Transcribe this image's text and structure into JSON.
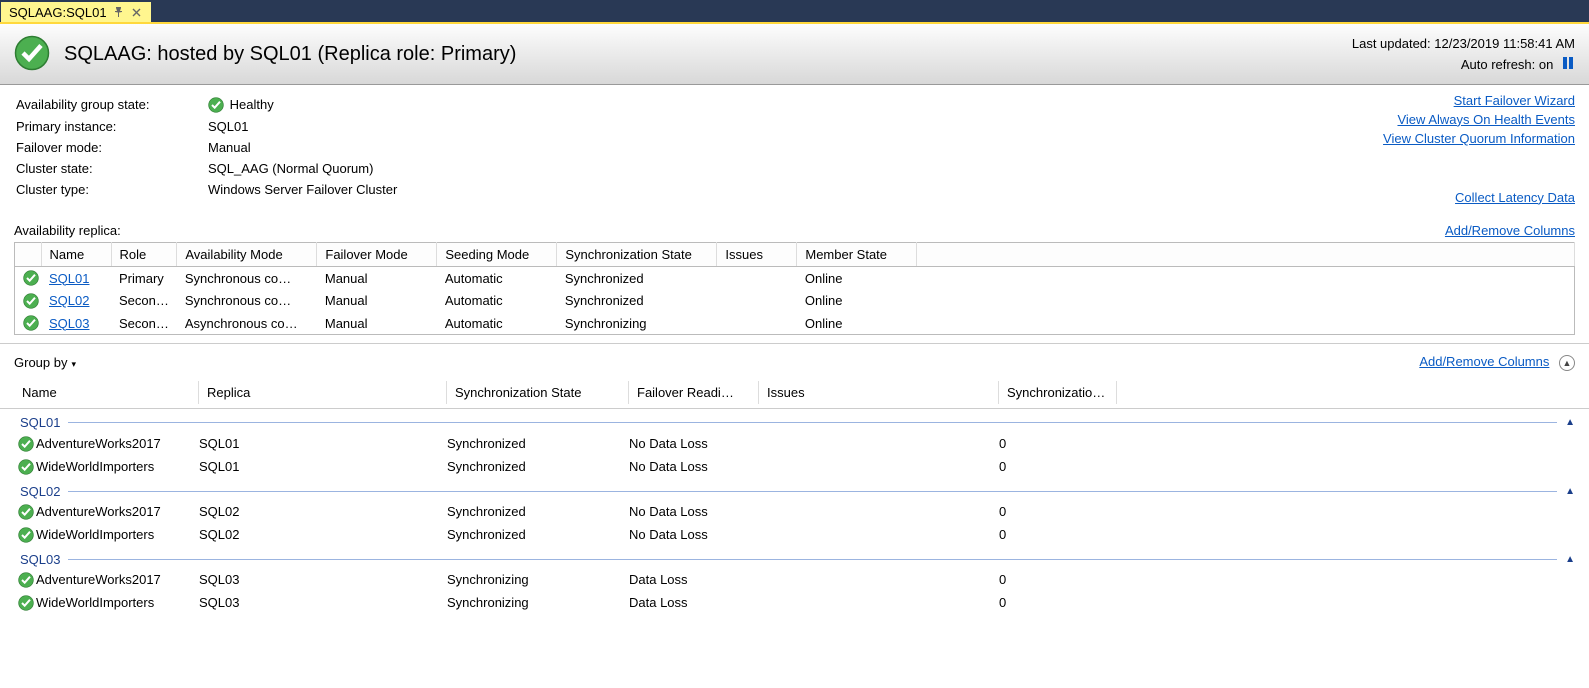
{
  "tab": {
    "title": "SQLAAG:SQL01"
  },
  "header": {
    "title": "SQLAAG: hosted by SQL01 (Replica role: Primary)",
    "lastUpdatedLabel": "Last updated:",
    "lastUpdatedValue": "12/23/2019 11:58:41 AM",
    "autoRefreshLabel": "Auto refresh:",
    "autoRefreshValue": "on"
  },
  "info": {
    "rows": [
      {
        "label": "Availability group state:",
        "value": "Healthy",
        "icon": true
      },
      {
        "label": "Primary instance:",
        "value": "SQL01"
      },
      {
        "label": "Failover mode:",
        "value": "Manual"
      },
      {
        "label": "Cluster state:",
        "value": "SQL_AAG (Normal Quorum)"
      },
      {
        "label": "Cluster type:",
        "value": "Windows Server Failover Cluster"
      }
    ],
    "links": {
      "failoverWizard": "Start Failover Wizard",
      "healthEvents": "View Always On Health Events",
      "quorum": "View Cluster Quorum Information",
      "latency": "Collect Latency Data"
    }
  },
  "replicaSection": {
    "label": "Availability replica:",
    "addRemove": "Add/Remove Columns",
    "headers": [
      "Name",
      "Role",
      "Availability Mode",
      "Failover Mode",
      "Seeding Mode",
      "Synchronization State",
      "Issues",
      "Member State"
    ],
    "rows": [
      {
        "name": "SQL01",
        "role": "Primary",
        "mode": "Synchronous co…",
        "failover": "Manual",
        "seeding": "Automatic",
        "sync": "Synchronized",
        "issues": "",
        "member": "Online"
      },
      {
        "name": "SQL02",
        "role": "Secon…",
        "mode": "Synchronous co…",
        "failover": "Manual",
        "seeding": "Automatic",
        "sync": "Synchronized",
        "issues": "",
        "member": "Online"
      },
      {
        "name": "SQL03",
        "role": "Secon…",
        "mode": "Asynchronous co…",
        "failover": "Manual",
        "seeding": "Automatic",
        "sync": "Synchronizing",
        "issues": "",
        "member": "Online"
      }
    ]
  },
  "dbSection": {
    "groupBy": "Group by",
    "addRemove": "Add/Remove Columns",
    "headers": {
      "name": "Name",
      "replica": "Replica",
      "sync": "Synchronization State",
      "failover": "Failover Readi…",
      "issues": "Issues",
      "perf": "Synchronizatio…"
    },
    "groups": [
      {
        "name": "SQL01",
        "rows": [
          {
            "db": "AdventureWorks2017",
            "replica": "SQL01",
            "sync": "Synchronized",
            "failover": "No Data Loss",
            "issues": "",
            "perf": "0"
          },
          {
            "db": "WideWorldImporters",
            "replica": "SQL01",
            "sync": "Synchronized",
            "failover": "No Data Loss",
            "issues": "",
            "perf": "0"
          }
        ]
      },
      {
        "name": "SQL02",
        "rows": [
          {
            "db": "AdventureWorks2017",
            "replica": "SQL02",
            "sync": "Synchronized",
            "failover": "No Data Loss",
            "issues": "",
            "perf": "0"
          },
          {
            "db": "WideWorldImporters",
            "replica": "SQL02",
            "sync": "Synchronized",
            "failover": "No Data Loss",
            "issues": "",
            "perf": "0"
          }
        ]
      },
      {
        "name": "SQL03",
        "rows": [
          {
            "db": "AdventureWorks2017",
            "replica": "SQL03",
            "sync": "Synchronizing",
            "failover": "Data Loss",
            "issues": "",
            "perf": "0"
          },
          {
            "db": "WideWorldImporters",
            "replica": "SQL03",
            "sync": "Synchronizing",
            "failover": "Data Loss",
            "issues": "",
            "perf": "0"
          }
        ]
      }
    ]
  }
}
